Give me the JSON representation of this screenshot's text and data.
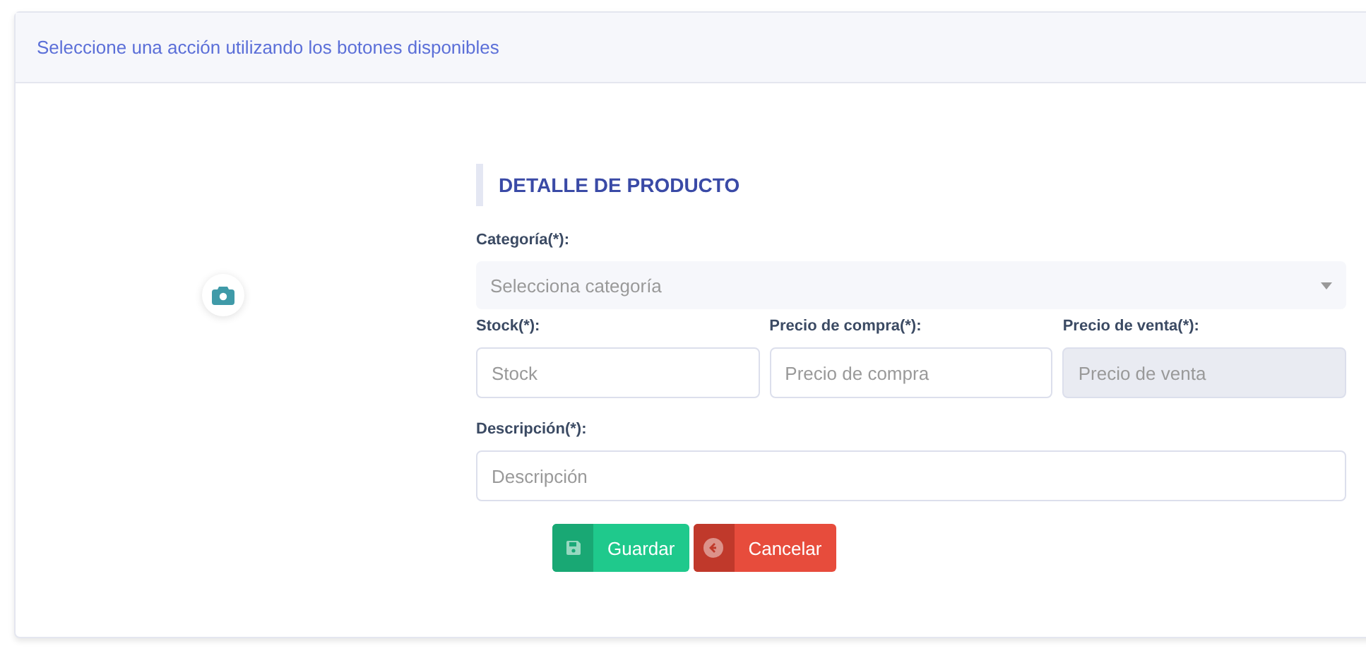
{
  "header": {
    "text": "Seleccione una acción utilizando los botones disponibles"
  },
  "section_title": "DETALLE DE PRODUCTO",
  "category": {
    "label": "Categoría(*):",
    "placeholder": "Selecciona categoría"
  },
  "price_fields": [
    {
      "label": "Stock(*):",
      "placeholder": "Stock",
      "disabled": false
    },
    {
      "label": "Precio de compra(*):",
      "placeholder": "Precio de compra",
      "disabled": false
    },
    {
      "label": "Precio de venta(*):",
      "placeholder": "Precio de venta",
      "disabled": true
    }
  ],
  "description": {
    "label": "Descripción(*):",
    "placeholder": "Descripción"
  },
  "buttons": [
    {
      "label": "Guardar",
      "kind": "save"
    },
    {
      "label": "Cancelar",
      "kind": "cancel"
    }
  ]
}
